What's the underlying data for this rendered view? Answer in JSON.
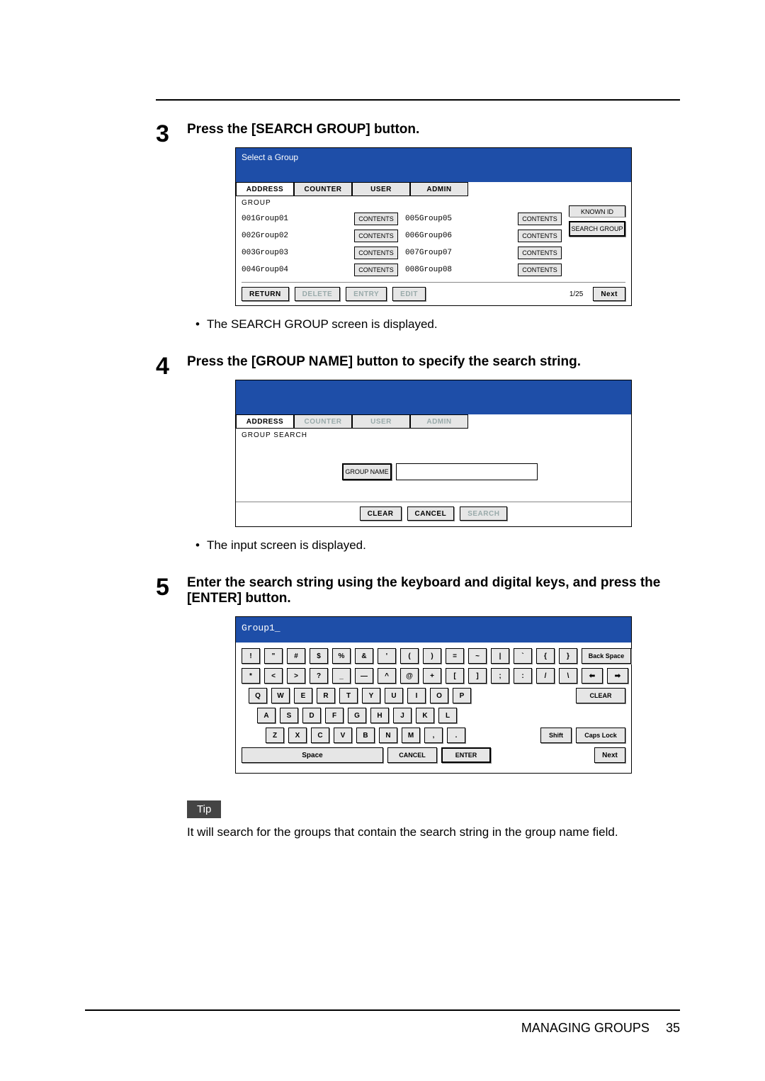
{
  "steps": {
    "s3": {
      "num": "3",
      "title": "Press the [SEARCH GROUP] button.",
      "note": "The SEARCH GROUP screen is displayed."
    },
    "s4": {
      "num": "4",
      "title": "Press the [GROUP NAME] button to specify the search string.",
      "note": "The input screen is displayed."
    },
    "s5": {
      "num": "5",
      "title": "Enter the search string using the keyboard and digital keys, and press the [ENTER] button."
    }
  },
  "panel1": {
    "title": "Select a Group",
    "tabs": {
      "address": "ADDRESS",
      "counter": "COUNTER",
      "user": "USER",
      "admin": "ADMIN"
    },
    "sublabel": "GROUP",
    "side": {
      "knownid": "KNOWN ID",
      "searchgroup": "SEARCH GROUP"
    },
    "left": [
      {
        "id": "001",
        "name": "Group01"
      },
      {
        "id": "002",
        "name": "Group02"
      },
      {
        "id": "003",
        "name": "Group03"
      },
      {
        "id": "004",
        "name": "Group04"
      }
    ],
    "right": [
      {
        "id": "005",
        "name": "Group05"
      },
      {
        "id": "006",
        "name": "Group06"
      },
      {
        "id": "007",
        "name": "Group07"
      },
      {
        "id": "008",
        "name": "Group08"
      }
    ],
    "contents": "CONTENTS",
    "footer": {
      "return": "RETURN",
      "delete": "DELETE",
      "entry": "ENTRY",
      "edit": "EDIT",
      "page": "1/25",
      "next": "Next"
    }
  },
  "panel2": {
    "tabs": {
      "address": "ADDRESS",
      "counter": "COUNTER",
      "user": "USER",
      "admin": "ADMIN"
    },
    "sublabel": "GROUP SEARCH",
    "groupname_btn": "GROUP NAME",
    "footer": {
      "clear": "CLEAR",
      "cancel": "CANCEL",
      "search": "SEARCH"
    }
  },
  "panel3": {
    "display": "Group1_",
    "rows": {
      "r1": [
        "!",
        "\"",
        "#",
        "$",
        "%",
        "&",
        "'",
        "(",
        ")",
        "=",
        "~",
        "|",
        "`",
        "{",
        "}"
      ],
      "r1_right": "Back Space",
      "r2": [
        "*",
        "<",
        ">",
        "?",
        "_",
        "—",
        "^",
        "@",
        "+",
        "[",
        "]",
        ";",
        ":",
        "/",
        "\\"
      ],
      "r2_left": "⬅",
      "r2_right": "➡",
      "r3": [
        "Q",
        "W",
        "E",
        "R",
        "T",
        "Y",
        "U",
        "I",
        "O",
        "P"
      ],
      "r3_right": "CLEAR",
      "r4": [
        "A",
        "S",
        "D",
        "F",
        "G",
        "H",
        "J",
        "K",
        "L"
      ],
      "r5": [
        "Z",
        "X",
        "C",
        "V",
        "B",
        "N",
        "M",
        ",",
        "."
      ],
      "r5_shift": "Shift",
      "r5_caps": "Caps Lock",
      "bottom": {
        "space": "Space",
        "cancel": "CANCEL",
        "enter": "ENTER",
        "next": "Next"
      }
    }
  },
  "tip": {
    "label": "Tip",
    "text": "It will search for the groups that contain the search string in the group name field."
  },
  "footer": {
    "section": "MANAGING GROUPS",
    "page": "35"
  }
}
